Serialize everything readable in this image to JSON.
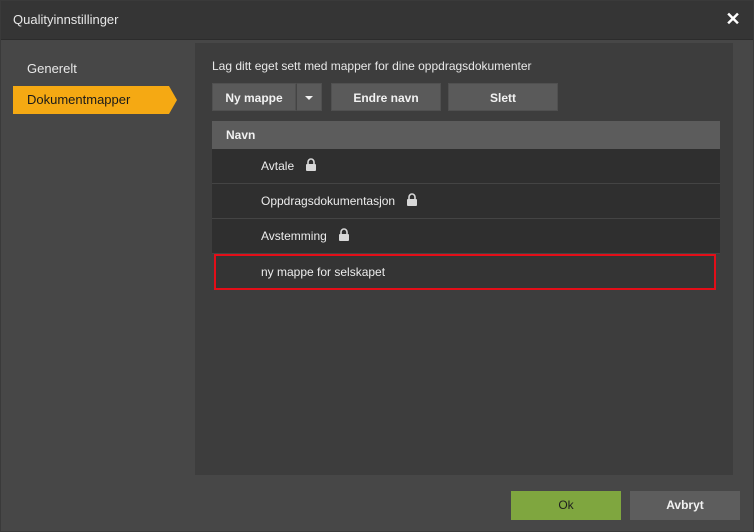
{
  "window": {
    "title": "Qualityinnstillinger",
    "close_glyph": "✕"
  },
  "sidebar": {
    "items": [
      {
        "label": "Generelt",
        "active": false
      },
      {
        "label": "Dokumentmapper",
        "active": true
      }
    ]
  },
  "main": {
    "description": "Lag ditt eget sett med mapper for dine oppdragsdokumenter",
    "toolbar": {
      "new_label": "Ny mappe",
      "rename_label": "Endre navn",
      "delete_label": "Slett"
    },
    "table": {
      "header": "Navn",
      "rows": [
        {
          "name": "Avtale",
          "locked": true
        },
        {
          "name": "Oppdragsdokumentasjon",
          "locked": true
        },
        {
          "name": "Avstemming",
          "locked": true
        },
        {
          "name": "ny mappe for selskapet",
          "locked": false
        }
      ]
    }
  },
  "footer": {
    "ok_label": "Ok",
    "cancel_label": "Avbryt"
  },
  "colors": {
    "accent": "#f5a913",
    "ok": "#7fa63f",
    "highlight": "#e30e18"
  }
}
